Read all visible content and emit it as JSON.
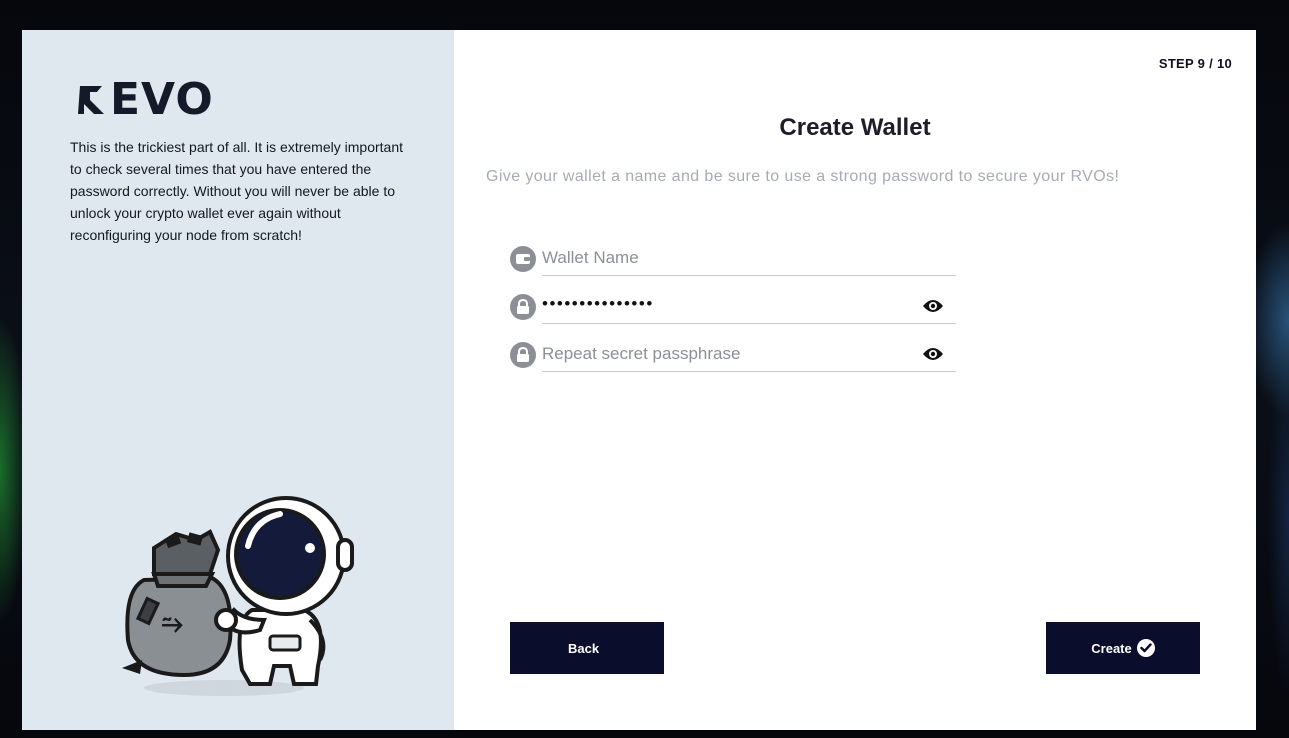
{
  "brand": {
    "logo_text": "EVO"
  },
  "sidebar": {
    "description": "This is the trickiest part of all. It is extremely important to check several times that you have entered the password correctly. Without you will never be able to unlock your crypto wallet ever again without reconfiguring your node from scratch!"
  },
  "header": {
    "step": "STEP 9 / 10"
  },
  "main": {
    "title": "Create Wallet",
    "subtitle": "Give your wallet a name and be sure to use a strong password to secure your RVOs!"
  },
  "form": {
    "wallet_name": {
      "value": "",
      "placeholder": "Wallet Name",
      "icon": "wallet-icon"
    },
    "password": {
      "value": "•••••••••••••••",
      "icon": "lock-icon",
      "toggle_icon": "eye-icon"
    },
    "repeat_password": {
      "value": "",
      "placeholder": "Repeat secret passphrase",
      "icon": "lock-icon",
      "toggle_icon": "eye-icon"
    }
  },
  "actions": {
    "back_label": "Back",
    "create_label": "Create",
    "create_icon": "check-circle-icon"
  },
  "colors": {
    "sidebar_bg": "#dfe8ef",
    "button_bg": "#0b0d2c",
    "muted_text": "#a7abb4"
  }
}
